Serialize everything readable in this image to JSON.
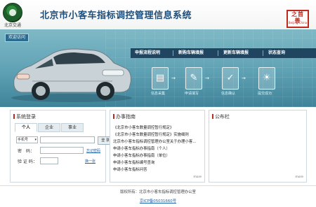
{
  "header": {
    "logo_text": "北京交通",
    "site_title": "北京市小客车指标调控管理信息系统",
    "brand_badge_zh": "之首善",
    "brand_badge_en": "Beijing China"
  },
  "banner": {
    "welcome_tag": "欢迎访问",
    "nav": [
      {
        "label": "申报流程说明"
      },
      {
        "label": "新购车辆填报"
      },
      {
        "label": "更新车辆填报"
      },
      {
        "label": "状态查询"
      }
    ],
    "steps": [
      {
        "label": "信息采集",
        "icon": "document-icon"
      },
      {
        "label": "申请填写",
        "icon": "edit-icon"
      },
      {
        "label": "信息确认",
        "icon": "mobile-check-icon"
      },
      {
        "label": "提交成功",
        "icon": "lightbulb-icon"
      }
    ]
  },
  "login": {
    "title": "系统登录",
    "tabs": [
      "个人",
      "企业",
      "事业"
    ],
    "account_type": "手机号",
    "password_label": "密　码：",
    "captcha_label": "验 证 码：",
    "login_button": "登 录",
    "forgot_password": "忘记密码",
    "refresh_captcha": "换一张"
  },
  "guide": {
    "title": "办事指南",
    "items": [
      "《北京市小客车数量调控暂行规定》",
      "《北京市小客车数量调控暂行规定》实施细则",
      "北京市小客车指标调控管理办公室关于办理小客...",
      "申请小客车指标办事指南（个人）",
      "申请小客车指标办事指南（单位）",
      "申请小客车指标编号查询",
      "申请小客车指标问答"
    ],
    "more": "more"
  },
  "bulletin": {
    "title": "公布栏",
    "more": "more"
  },
  "footer": {
    "copyright": "版权所有：北京市小客车指标调控管理办公室",
    "icp": "京ICP备05031660号"
  }
}
